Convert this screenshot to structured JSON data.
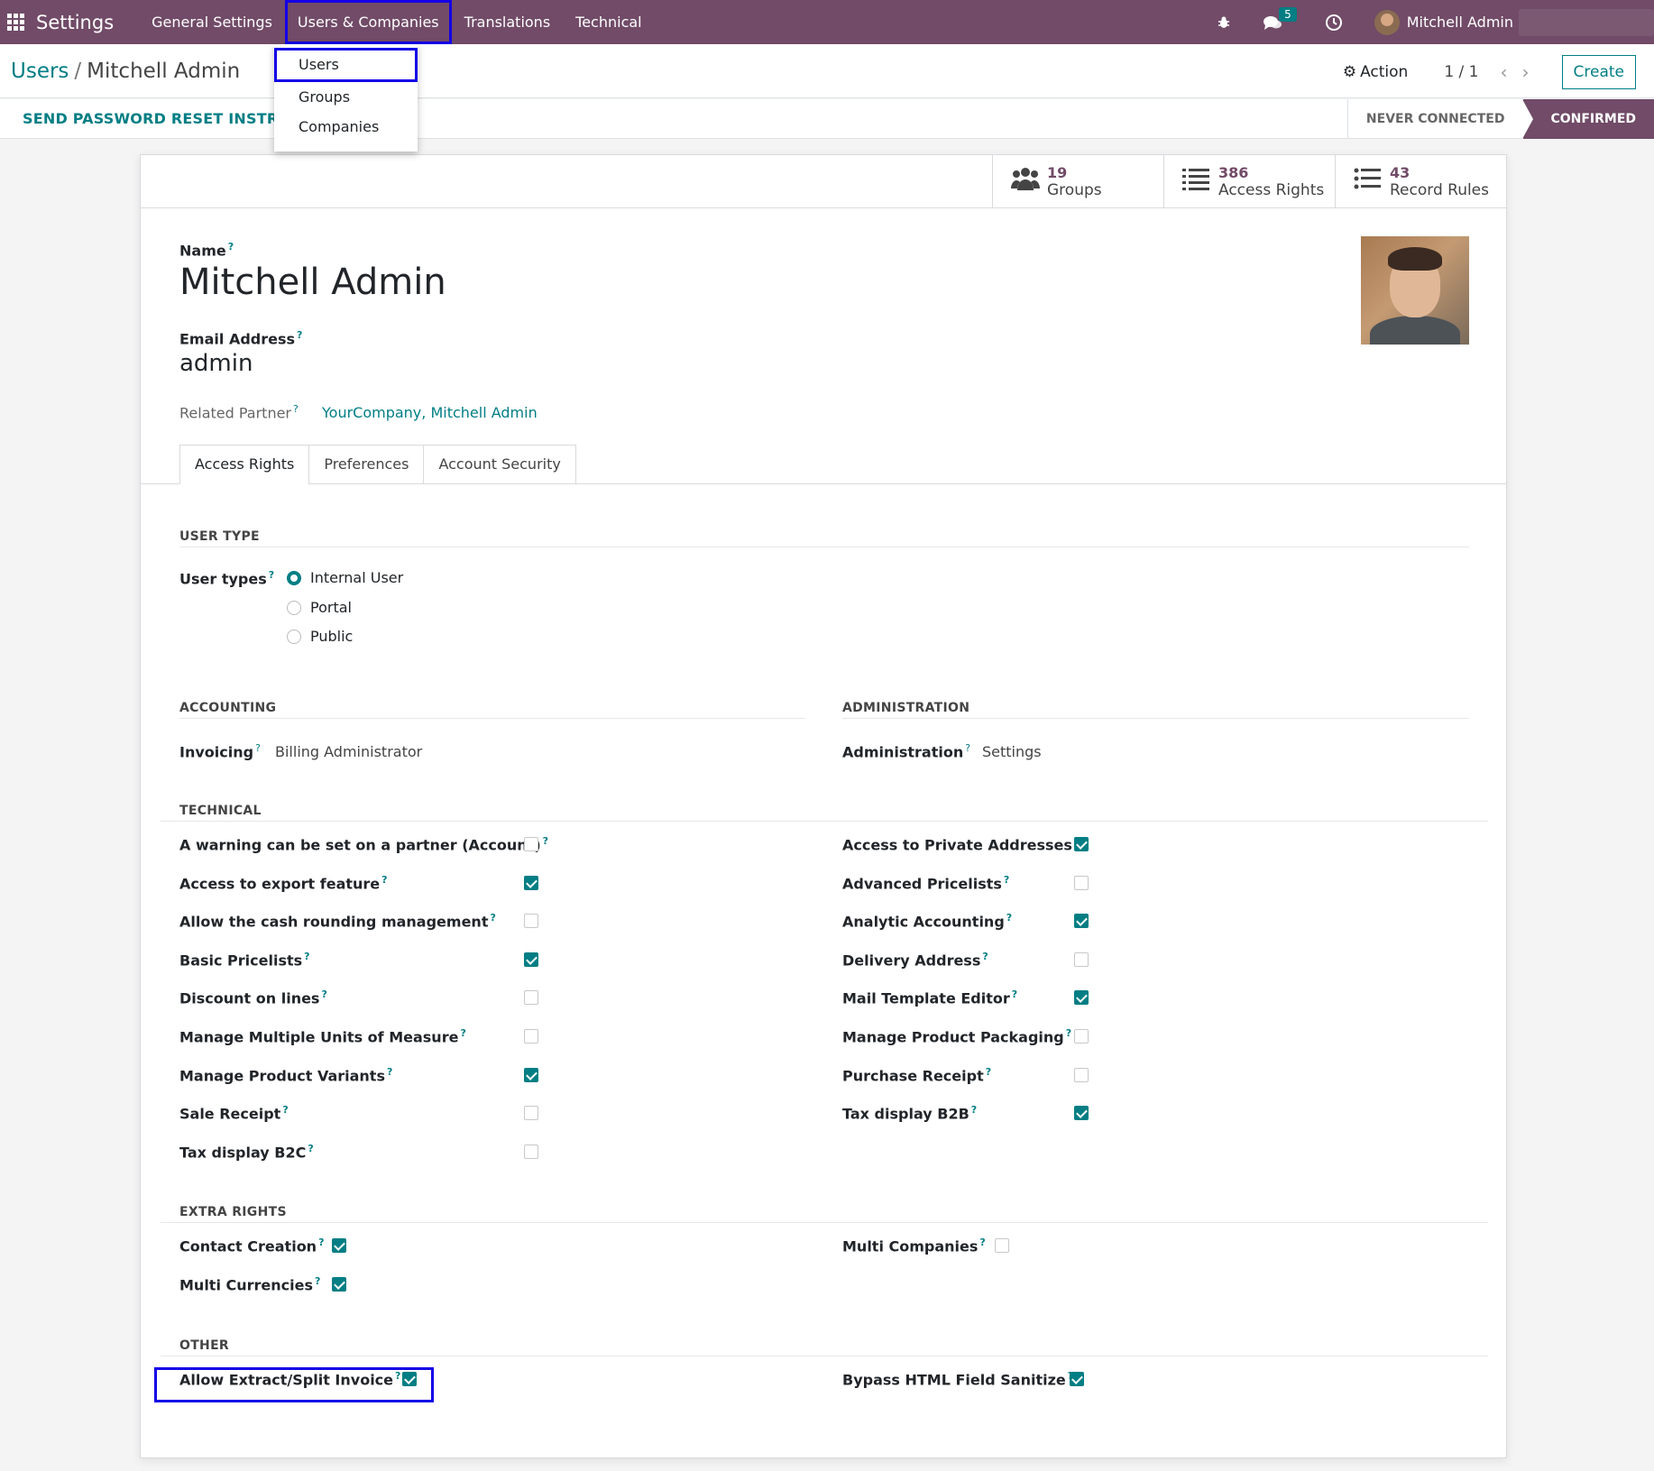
{
  "topnav": {
    "app_name": "Settings",
    "menu": [
      "General Settings",
      "Users & Companies",
      "Translations",
      "Technical"
    ],
    "message_count": "5",
    "user_name": "Mitchell Admin"
  },
  "dropdown": {
    "items": [
      "Users",
      "Groups",
      "Companies"
    ]
  },
  "control": {
    "breadcrumb_parent": "Users",
    "breadcrumb_separator": "/",
    "breadcrumb_current": "Mitchell Admin",
    "action_label": "Action",
    "pager": "1 / 1",
    "create_label": "Create"
  },
  "statusbar": {
    "reset_button": "SEND PASSWORD RESET INSTRUCT",
    "stages": [
      "NEVER CONNECTED",
      "CONFIRMED"
    ]
  },
  "smart_buttons": [
    {
      "count": "19",
      "label": "Groups"
    },
    {
      "count": "386",
      "label": "Access Rights"
    },
    {
      "count": "43",
      "label": "Record Rules"
    }
  ],
  "form": {
    "name_label": "Name",
    "name_value": "Mitchell Admin",
    "email_label": "Email Address",
    "email_value": "admin",
    "partner_label": "Related Partner",
    "partner_value": "YourCompany, Mitchell Admin",
    "help_mark": "?"
  },
  "tabs": [
    "Access Rights",
    "Preferences",
    "Account Security"
  ],
  "user_type": {
    "section": "USER TYPE",
    "label": "User types",
    "options": [
      "Internal User",
      "Portal",
      "Public"
    ],
    "selected": "Internal User"
  },
  "accounting": {
    "section": "ACCOUNTING",
    "field_label": "Invoicing",
    "field_value": "Billing Administrator"
  },
  "administration": {
    "section": "ADMINISTRATION",
    "field_label": "Administration",
    "field_value": "Settings"
  },
  "technical": {
    "section": "TECHNICAL",
    "left": [
      {
        "label": "A warning can be set on a partner (Account)",
        "checked": false
      },
      {
        "label": "Access to export feature",
        "checked": true
      },
      {
        "label": "Allow the cash rounding management",
        "checked": false
      },
      {
        "label": "Basic Pricelists",
        "checked": true
      },
      {
        "label": "Discount on lines",
        "checked": false
      },
      {
        "label": "Manage Multiple Units of Measure",
        "checked": false
      },
      {
        "label": "Manage Product Variants",
        "checked": true
      },
      {
        "label": "Sale Receipt",
        "checked": false
      },
      {
        "label": "Tax display B2C",
        "checked": false
      }
    ],
    "right": [
      {
        "label": "Access to Private Addresses",
        "checked": true
      },
      {
        "label": "Advanced Pricelists",
        "checked": false
      },
      {
        "label": "Analytic Accounting",
        "checked": true
      },
      {
        "label": "Delivery Address",
        "checked": false
      },
      {
        "label": "Mail Template Editor",
        "checked": true
      },
      {
        "label": "Manage Product Packaging",
        "checked": false
      },
      {
        "label": "Purchase Receipt",
        "checked": false
      },
      {
        "label": "Tax display B2B",
        "checked": true
      }
    ]
  },
  "extra_rights": {
    "section": "EXTRA RIGHTS",
    "left": [
      {
        "label": "Contact Creation",
        "checked": true
      },
      {
        "label": "Multi Currencies",
        "checked": true
      }
    ],
    "right": [
      {
        "label": "Multi Companies",
        "checked": false
      }
    ]
  },
  "other": {
    "section": "OTHER",
    "left": [
      {
        "label": "Allow Extract/Split Invoice",
        "checked": true
      }
    ],
    "right": [
      {
        "label": "Bypass HTML Field Sanitize",
        "checked": true
      }
    ]
  },
  "colors": {
    "brand": "#714B67",
    "accent": "#017e84",
    "highlight": "#1400e6"
  }
}
